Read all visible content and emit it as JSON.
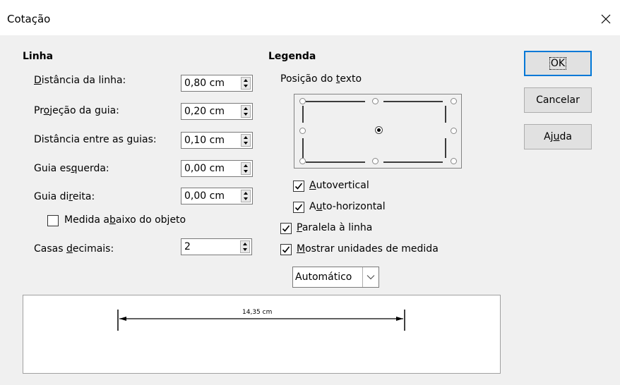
{
  "window": {
    "title": "Cotação"
  },
  "linha": {
    "title": "Linha",
    "fields": [
      {
        "label_pre": "",
        "label_u": "D",
        "label_post": "istância da linha:",
        "value": "0,80 cm"
      },
      {
        "label_pre": "Pr",
        "label_u": "o",
        "label_post": "jeção da guia:",
        "value": "0,20 cm"
      },
      {
        "label_pre": "Distância entre as ",
        "label_u": "g",
        "label_post": "uias:",
        "value": "0,10 cm"
      },
      {
        "label_pre": "Guia es",
        "label_u": "q",
        "label_post": "uerda:",
        "value": "0,00 cm"
      },
      {
        "label_pre": "Guia di",
        "label_u": "r",
        "label_post": "eita:",
        "value": "0,00 cm"
      }
    ],
    "below_object": {
      "label_pre": "Medida a",
      "label_u": "b",
      "label_post": "aixo do objeto",
      "checked": false
    },
    "decimals": {
      "label_pre": "Casas ",
      "label_u": "d",
      "label_post": "ecimais:",
      "value": "2"
    }
  },
  "legenda": {
    "title": "Legenda",
    "position_label_pre": "Posição do ",
    "position_label_u": "t",
    "position_label_post": "exto",
    "auto_vertical": {
      "label_pre": "",
      "label_u": "A",
      "label_post": "utovertical",
      "checked": true
    },
    "auto_horizontal": {
      "label_pre": "A",
      "label_u": "u",
      "label_post": "to-horizontal",
      "checked": true
    },
    "parallel": {
      "label_pre": "",
      "label_u": "P",
      "label_post": "aralela à linha",
      "checked": true
    },
    "show_units": {
      "label_pre": "",
      "label_u": "M",
      "label_post": "ostrar unidades de medida",
      "checked": true
    },
    "unit_select": {
      "value": "Automático"
    }
  },
  "buttons": {
    "ok": "OK",
    "cancel": "Cancelar",
    "help_pre": "Aj",
    "help_u": "u",
    "help_post": "da"
  },
  "preview": {
    "measure_text": "14,35 cm"
  }
}
